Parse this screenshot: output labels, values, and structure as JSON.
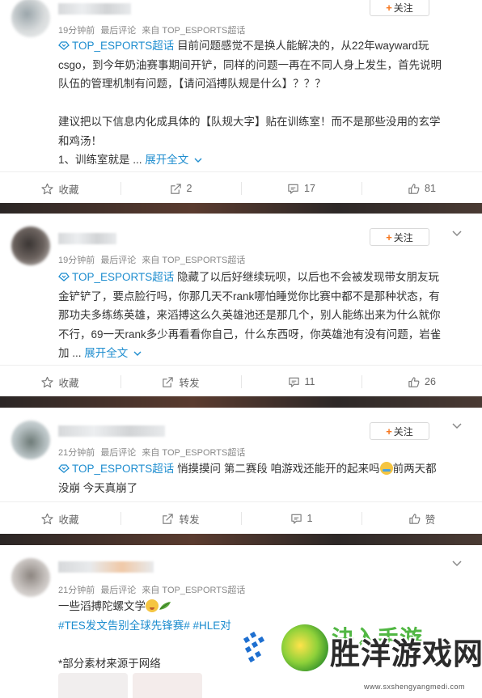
{
  "posts": [
    {
      "time": "19分钟前",
      "source_prefix": "最后评论",
      "source": "来自 TOP_ESPORTS超话",
      "follow_label": "关注",
      "topic": "TOP_ESPORTS超话",
      "lines": [
        "目前问题感觉不是换人能解决的，从22年wayward玩",
        "csgo，到今年奶油赛事期间开铲，同样的问题一再在不同人身上发生，首先说明",
        "队伍的管理机制有问题，【请问滔搏队规是什么】？？？",
        "",
        "建议把以下信息内化成具体的【队规大字】贴在训练室！而不是那些没用的玄学",
        "和鸡汤！",
        "1、训练室就是 ..."
      ],
      "expand": "展开全文",
      "actions": {
        "fav": "收藏",
        "repost": "2",
        "comment": "17",
        "like": "81"
      }
    },
    {
      "time": "19分钟前",
      "source_prefix": "最后评论",
      "source": "来自 TOP_ESPORTS超话",
      "follow_label": "关注",
      "topic": "TOP_ESPORTS超话",
      "lines": [
        "隐藏了以后好继续玩呗，以后也不会被发现带女朋友玩",
        "金铲铲了，要点脸行吗，你那几天不rank哪怕睡觉你比赛中都不是那种状态，有",
        "那功夫多练练英雄，来滔搏这么久英雄池还是那几个，别人能练出来为什么就你",
        "不行，69一天rank多少再看看你自己，什么东西呀，你英雄池有没有问题，岩雀",
        "加 ..."
      ],
      "expand": "展开全文",
      "actions": {
        "fav": "收藏",
        "repost": "转发",
        "comment": "11",
        "like": "26"
      }
    },
    {
      "time": "21分钟前",
      "source_prefix": "最后评论",
      "source": "来自 TOP_ESPORTS超话",
      "follow_label": "关注",
      "topic": "TOP_ESPORTS超话",
      "line1": "悄摸摸问 第二赛段 咱游戏还能开的起来吗",
      "line1_after": "前两天都",
      "line2": "没崩 今天真崩了",
      "actions": {
        "fav": "收藏",
        "repost": "转发",
        "comment": "1",
        "like": "赞"
      }
    },
    {
      "time": "21分钟前",
      "source_prefix": "最后评论",
      "source": "来自 TOP_ESPORTS超话",
      "line1": "一些滔搏陀螺文学",
      "hashtags": "#TES发文告别全球先锋赛# #HLE对",
      "note": "*部分素材来源于网络"
    }
  ],
  "watermark": {
    "top_text": "決入手游",
    "title": "胜洋游戏网",
    "url": "www.sxshengyangmedi.com"
  },
  "colors": {
    "link": "#1e8dcf",
    "follow_plus": "#f7771f",
    "background": "#3a3433"
  }
}
